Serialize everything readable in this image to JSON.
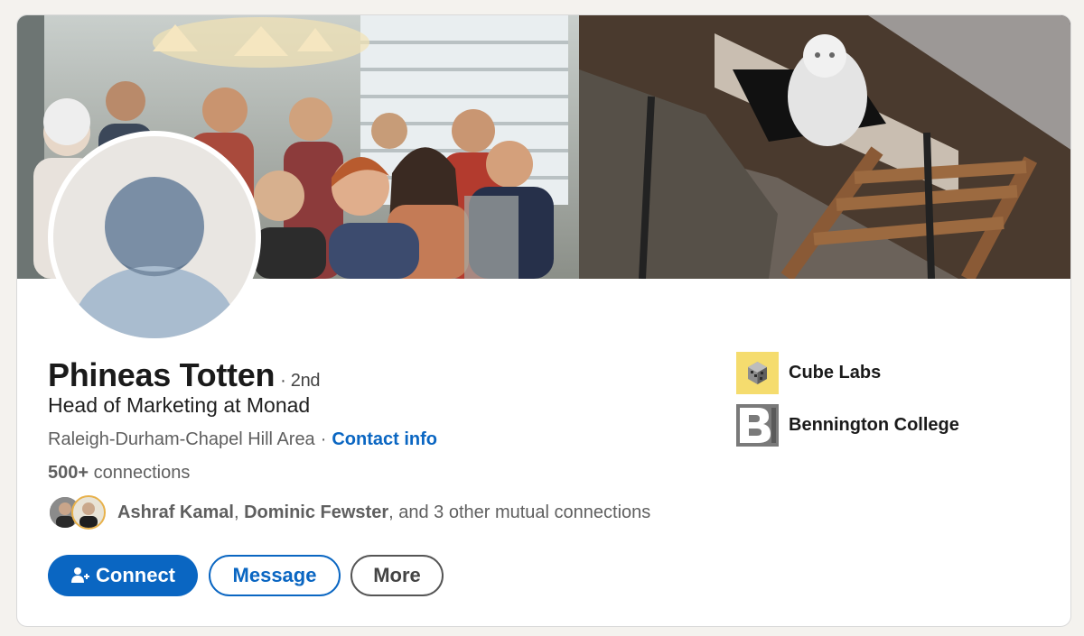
{
  "profile": {
    "name": "Phineas Totten",
    "degree": "· 2nd",
    "headline": "Head of Marketing at Monad",
    "location": "Raleigh-Durham-Chapel Hill Area",
    "location_separator": "·",
    "contact_info_label": "Contact info",
    "connections_count": "500+",
    "connections_label": "connections"
  },
  "mutual": {
    "name1": "Ashraf Kamal",
    "sep": ",",
    "name2": "Dominic Fewster",
    "rest": ", and 3 other mutual connections"
  },
  "actions": {
    "connect_label": "Connect",
    "message_label": "Message",
    "more_label": "More"
  },
  "organizations": [
    {
      "name": "Cube Labs",
      "icon": "cube-labs-logo"
    },
    {
      "name": "Bennington College",
      "icon": "bennington-college-logo"
    }
  ],
  "colors": {
    "accent": "#0a66c2",
    "page_bg": "#f4f2ee",
    "cube_labs_logo_bg": "#f5dc6e",
    "bennington_logo_bg": "#7a7a7a"
  }
}
